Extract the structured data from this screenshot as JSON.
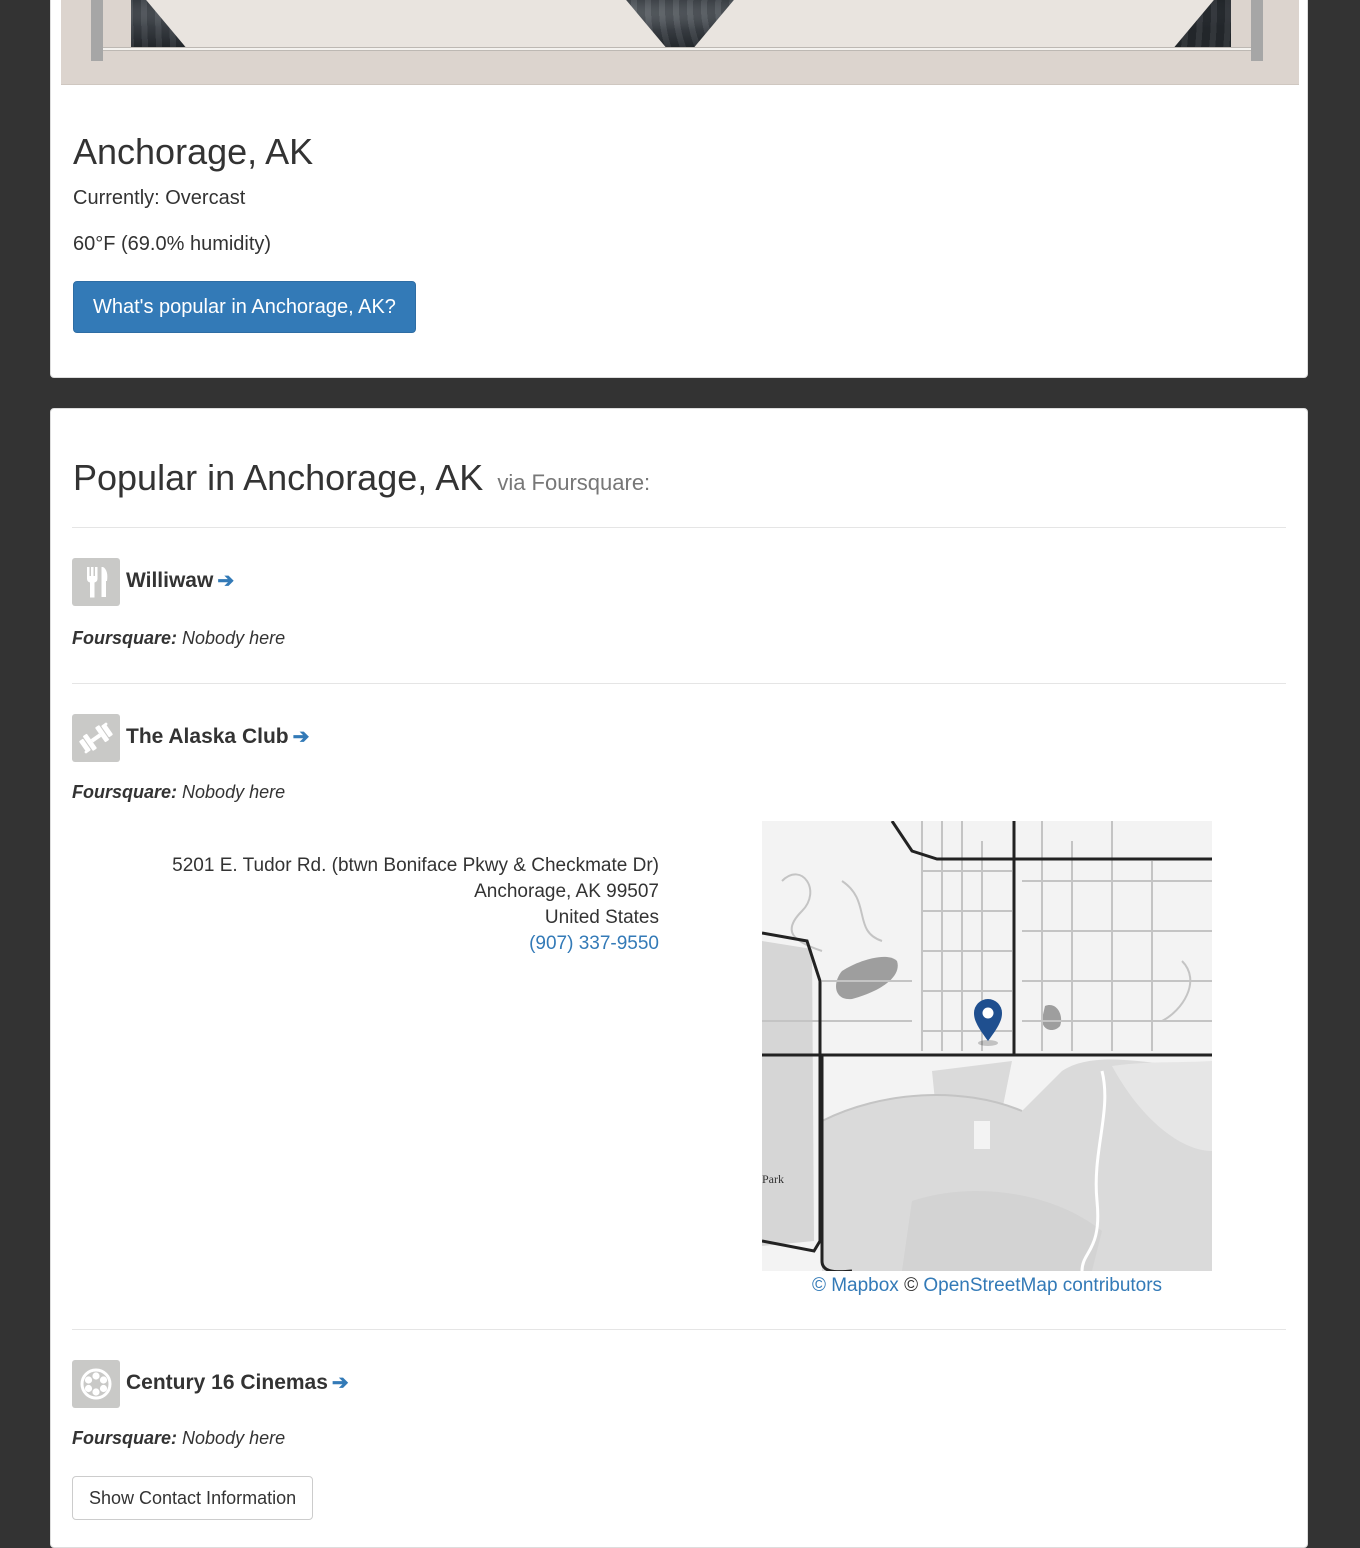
{
  "weather": {
    "city": "Anchorage, AK",
    "currently": "Currently: Overcast",
    "temperature": "60°F (69.0% humidity)",
    "popular_button": "What's popular in Anchorage, AK?"
  },
  "popular": {
    "title": "Popular in Anchorage, AK",
    "via": "via Foursquare:",
    "venues": [
      {
        "name": "Williwaw",
        "icon": "fork-knife-icon",
        "fsq_label": "Foursquare:",
        "fsq_status": "Nobody here"
      },
      {
        "name": "The Alaska Club",
        "icon": "dumbbell-icon",
        "fsq_label": "Foursquare:",
        "fsq_status": "Nobody here",
        "address_line1": "5201 E. Tudor Rd. (btwn Boniface Pkwy & Checkmate Dr)",
        "address_line2": "Anchorage, AK 99507",
        "address_line3": "United States",
        "phone": "(907) 337-9550",
        "map_label": "Park"
      },
      {
        "name": "Century 16 Cinemas",
        "icon": "film-reel-icon",
        "fsq_label": "Foursquare:",
        "fsq_status": "Nobody here",
        "contact_button": "Show Contact Information"
      }
    ],
    "arrow": "➔",
    "attribution": {
      "copy1": "© Mapbox",
      "copy2": "©",
      "copy3": "OpenStreetMap contributors"
    }
  },
  "colors": {
    "background": "#333333",
    "card": "#ffffff",
    "primary": "#337ab7",
    "muted": "#777777"
  }
}
